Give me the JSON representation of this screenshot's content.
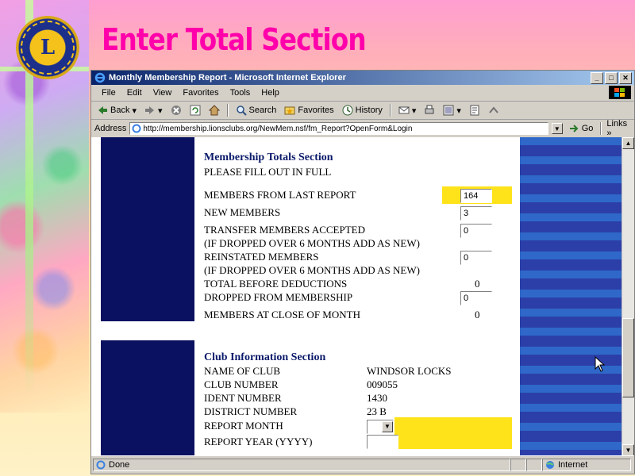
{
  "slide": {
    "title": "Enter Total Section",
    "logo_letter": "L"
  },
  "window": {
    "title": "Monthly Membership Report - Microsoft Internet Explorer",
    "buttons": {
      "minimize": "_",
      "maximize": "□",
      "close": "✕"
    }
  },
  "menu": {
    "items": [
      "File",
      "Edit",
      "View",
      "Favorites",
      "Tools",
      "Help"
    ]
  },
  "toolbar": {
    "back": "Back",
    "search": "Search",
    "favorites": "Favorites",
    "history": "History"
  },
  "address": {
    "label": "Address",
    "url": "http://membership.lionsclubs.org/NewMem.nsf/fm_Report?OpenForm&Login",
    "go": "Go",
    "links": "Links"
  },
  "totals": {
    "title": "Membership Totals Section",
    "subtitle": "PLEASE FILL OUT IN FULL",
    "rows": [
      {
        "label": "MEMBERS FROM LAST REPORT",
        "value": "164"
      },
      {
        "label": "NEW MEMBERS",
        "value": "3"
      },
      {
        "label": "TRANSFER MEMBERS ACCEPTED",
        "value": "0"
      },
      {
        "label": "(IF DROPPED OVER 6 MONTHS ADD AS NEW)"
      },
      {
        "label": "REINSTATED MEMBERS",
        "value": "0"
      },
      {
        "label": "(IF DROPPED OVER 6 MONTHS ADD AS NEW)"
      },
      {
        "label": "TOTAL BEFORE DEDUCTIONS",
        "value": "0"
      },
      {
        "label": "DROPPED FROM MEMBERSHIP",
        "value": "0"
      },
      {
        "label": "MEMBERS AT CLOSE OF MONTH",
        "value": "0"
      }
    ]
  },
  "club": {
    "title": "Club Information Section",
    "rows": [
      {
        "label": "NAME OF CLUB",
        "value": "WINDSOR LOCKS"
      },
      {
        "label": "CLUB NUMBER",
        "value": "009055"
      },
      {
        "label": "IDENT NUMBER",
        "value": "1430"
      },
      {
        "label": "DISTRICT NUMBER",
        "value": "23 B"
      },
      {
        "label": "REPORT MONTH",
        "value": ""
      },
      {
        "label": "REPORT YEAR (YYYY)",
        "value": ""
      }
    ]
  },
  "status": {
    "left": "Done",
    "zone": "Internet"
  },
  "colors": {
    "title_pink": "#ff00aa",
    "navy": "#0a1160",
    "highlight_yellow": "#ffe31a"
  }
}
